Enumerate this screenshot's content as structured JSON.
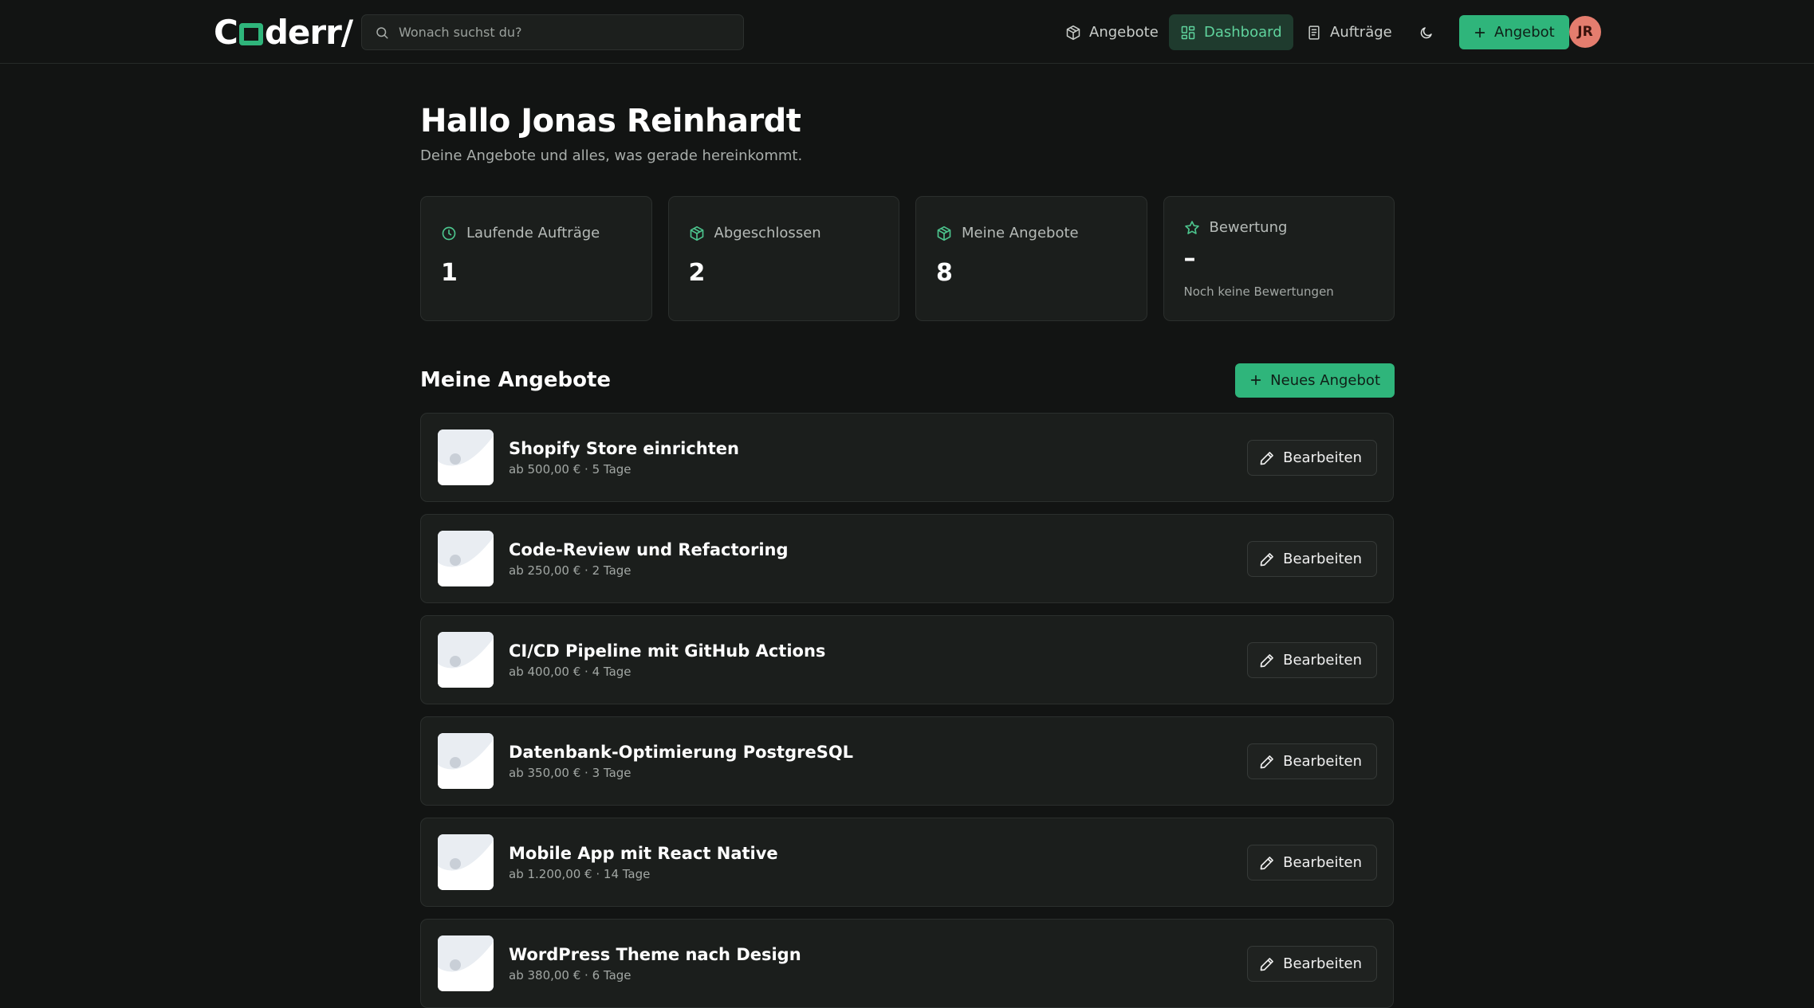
{
  "app": {
    "logo_text_before": "C",
    "logo_text_after": "derr/"
  },
  "search": {
    "placeholder": "Wonach suchst du?"
  },
  "nav": {
    "items": [
      {
        "label": "Angebote",
        "icon": "package-icon"
      },
      {
        "label": "Dashboard",
        "icon": "grid-icon",
        "active": true
      },
      {
        "label": "Aufträge",
        "icon": "document-icon"
      }
    ],
    "theme_icon": "moon-icon",
    "new_offer_label": "Angebot",
    "avatar_initials": "JR"
  },
  "colors": {
    "accent": "#2fb57b",
    "background": "#121413",
    "card": "#1b1e1c",
    "avatar": "#e47d6e"
  },
  "header": {
    "greeting": "Hallo Jonas Reinhardt",
    "subtitle": "Deine Angebote und alles, was gerade hereinkommt."
  },
  "stats": [
    {
      "label": "Laufende Aufträge",
      "value": "1",
      "icon": "clock-icon"
    },
    {
      "label": "Abgeschlossen",
      "value": "2",
      "icon": "package-icon"
    },
    {
      "label": "Meine Angebote",
      "value": "8",
      "icon": "package-icon"
    },
    {
      "label": "Bewertung",
      "value": "–",
      "note": "Noch keine Bewertungen",
      "icon": "star-icon"
    }
  ],
  "offers_section": {
    "title": "Meine Angebote",
    "new_button_label": "Neues Angebot",
    "edit_label": "Bearbeiten",
    "items": [
      {
        "title": "Shopify Store einrichten",
        "meta": "ab 500,00 € · 5 Tage"
      },
      {
        "title": "Code-Review und Refactoring",
        "meta": "ab 250,00 € · 2 Tage"
      },
      {
        "title": "CI/CD Pipeline mit GitHub Actions",
        "meta": "ab 400,00 € · 4 Tage"
      },
      {
        "title": "Datenbank-Optimierung PostgreSQL",
        "meta": "ab 350,00 € · 3 Tage"
      },
      {
        "title": "Mobile App mit React Native",
        "meta": "ab 1.200,00 € · 14 Tage"
      },
      {
        "title": "WordPress Theme nach Design",
        "meta": "ab 380,00 € · 6 Tage"
      }
    ]
  }
}
